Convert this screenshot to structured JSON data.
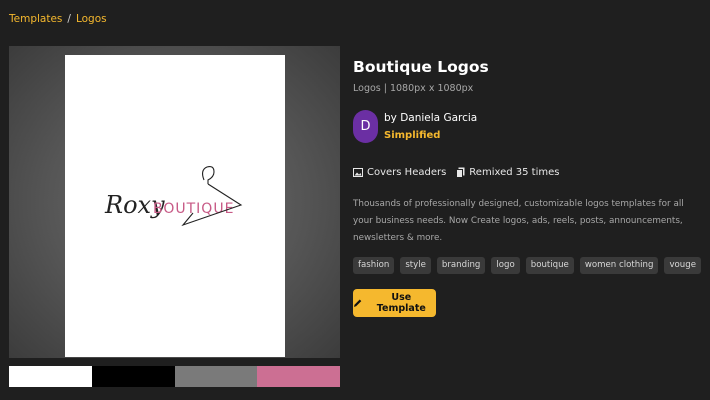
{
  "breadcrumb": {
    "items": [
      "Templates",
      "Logos"
    ],
    "separator": "/"
  },
  "template": {
    "title": "Boutique Logos",
    "subtitle": "Logos | 1080px x 1080px",
    "logo_text_script": "Roxy",
    "logo_text_caps": "BOUTIQUE"
  },
  "author": {
    "initial": "D",
    "name": "by Daniela Garcia",
    "org": "Simplified",
    "avatar_color": "#6b2fa3"
  },
  "meta": {
    "covers_label": "Covers Headers",
    "remixed_label": "Remixed 35 times"
  },
  "description": "Thousands of professionally designed, customizable logos templates for all your business needs. Now Create logos, ads, reels, posts, announcements, newsletters & more.",
  "tags": [
    "fashion",
    "style",
    "branding",
    "logo",
    "boutique",
    "women clothing",
    "vouge"
  ],
  "actions": {
    "use_template_label": "Use Template"
  },
  "palette": [
    "#ffffff",
    "#000000",
    "#7a7a7a",
    "#cc6f93"
  ],
  "colors": {
    "accent": "#f5b82e",
    "background": "#1f1f1f",
    "logo_pink": "#c75a86"
  }
}
